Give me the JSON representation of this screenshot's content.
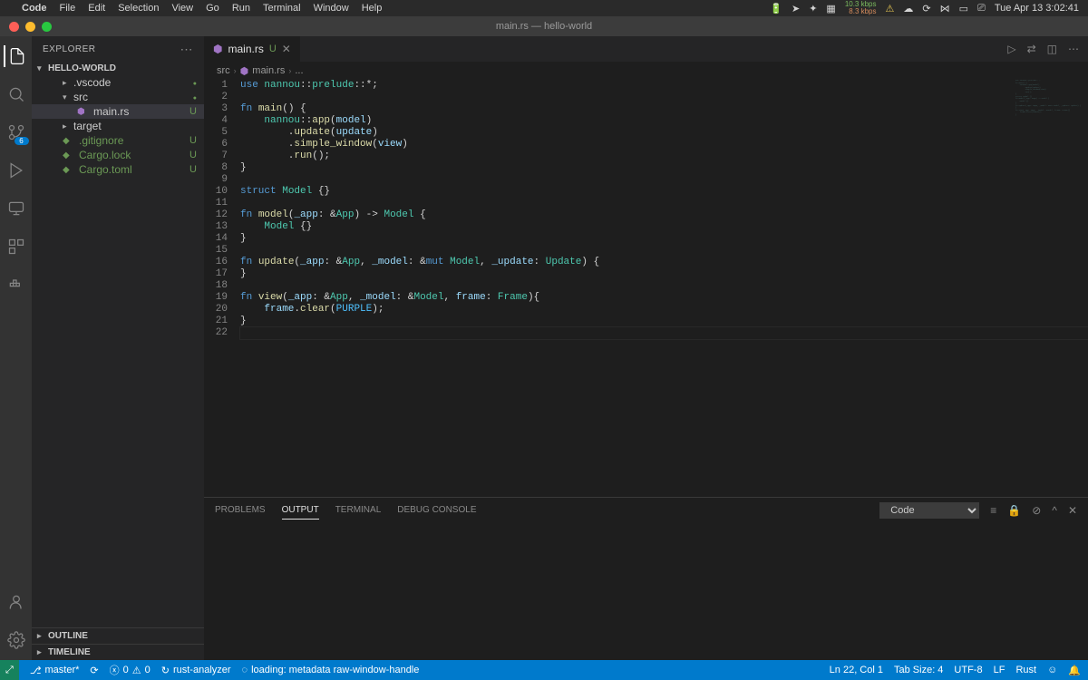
{
  "menubar": {
    "app": "Code",
    "items": [
      "File",
      "Edit",
      "Selection",
      "View",
      "Go",
      "Run",
      "Terminal",
      "Window",
      "Help"
    ],
    "clock": "Tue Apr 13  3:02:41",
    "net_up": "10.3 kbps",
    "net_down": "8.3 kbps"
  },
  "window": {
    "title": "main.rs — hello-world"
  },
  "sidebar": {
    "title": "EXPLORER",
    "root": "HELLO-WORLD",
    "items": [
      {
        "label": ".vscode",
        "type": "folder",
        "depth": 2,
        "status": "dot"
      },
      {
        "label": "src",
        "type": "folder-open",
        "depth": 2,
        "status": "dot"
      },
      {
        "label": "main.rs",
        "type": "file",
        "depth": 3,
        "status": "U",
        "selected": true
      },
      {
        "label": "target",
        "type": "folder",
        "depth": 2,
        "status": ""
      },
      {
        "label": ".gitignore",
        "type": "file",
        "depth": 2,
        "status": "U",
        "git": true
      },
      {
        "label": "Cargo.lock",
        "type": "file",
        "depth": 2,
        "status": "U",
        "git": true
      },
      {
        "label": "Cargo.toml",
        "type": "file",
        "depth": 2,
        "status": "U",
        "git": true
      }
    ],
    "outline": "OUTLINE",
    "timeline": "TIMELINE"
  },
  "activity": {
    "scm_badge": "6"
  },
  "editor": {
    "tab": {
      "icon": "⚙",
      "name": "main.rs",
      "mod": "U"
    },
    "breadcrumb": [
      "src",
      "main.rs",
      "..."
    ]
  },
  "code": {
    "lines": [
      [
        [
          "kw",
          "use"
        ],
        [
          "punc",
          " "
        ],
        [
          "mod",
          "nannou"
        ],
        [
          "punc",
          "::"
        ],
        [
          "mod",
          "prelude"
        ],
        [
          "punc",
          "::*;"
        ]
      ],
      [],
      [
        [
          "kw",
          "fn"
        ],
        [
          "punc",
          " "
        ],
        [
          "fn",
          "main"
        ],
        [
          "punc",
          "() {"
        ]
      ],
      [
        [
          "punc",
          "    "
        ],
        [
          "mod",
          "nannou"
        ],
        [
          "punc",
          "::"
        ],
        [
          "fn",
          "app"
        ],
        [
          "punc",
          "("
        ],
        [
          "var",
          "model"
        ],
        [
          "punc",
          ")"
        ]
      ],
      [
        [
          "punc",
          "        ."
        ],
        [
          "fn",
          "update"
        ],
        [
          "punc",
          "("
        ],
        [
          "var",
          "update"
        ],
        [
          "punc",
          ")"
        ]
      ],
      [
        [
          "punc",
          "        ."
        ],
        [
          "fn",
          "simple_window"
        ],
        [
          "punc",
          "("
        ],
        [
          "var",
          "view"
        ],
        [
          "punc",
          ")"
        ]
      ],
      [
        [
          "punc",
          "        ."
        ],
        [
          "fn",
          "run"
        ],
        [
          "punc",
          "();"
        ]
      ],
      [
        [
          "punc",
          "}"
        ]
      ],
      [],
      [
        [
          "kw",
          "struct"
        ],
        [
          "punc",
          " "
        ],
        [
          "type",
          "Model"
        ],
        [
          "punc",
          " {}"
        ]
      ],
      [],
      [
        [
          "kw",
          "fn"
        ],
        [
          "punc",
          " "
        ],
        [
          "fn",
          "model"
        ],
        [
          "punc",
          "("
        ],
        [
          "var",
          "_app"
        ],
        [
          "punc",
          ": &"
        ],
        [
          "type",
          "App"
        ],
        [
          "punc",
          ") -> "
        ],
        [
          "type",
          "Model"
        ],
        [
          "punc",
          " {"
        ]
      ],
      [
        [
          "punc",
          "    "
        ],
        [
          "type",
          "Model"
        ],
        [
          "punc",
          " {}"
        ]
      ],
      [
        [
          "punc",
          "}"
        ]
      ],
      [],
      [
        [
          "kw",
          "fn"
        ],
        [
          "punc",
          " "
        ],
        [
          "fn",
          "update"
        ],
        [
          "punc",
          "("
        ],
        [
          "var",
          "_app"
        ],
        [
          "punc",
          ": &"
        ],
        [
          "type",
          "App"
        ],
        [
          "punc",
          ", "
        ],
        [
          "var",
          "_model"
        ],
        [
          "punc",
          ": &"
        ],
        [
          "kw",
          "mut"
        ],
        [
          "punc",
          " "
        ],
        [
          "type",
          "Model"
        ],
        [
          "punc",
          ", "
        ],
        [
          "var",
          "_update"
        ],
        [
          "punc",
          ": "
        ],
        [
          "type",
          "Update"
        ],
        [
          "punc",
          ") {"
        ]
      ],
      [
        [
          "punc",
          "}"
        ]
      ],
      [],
      [
        [
          "kw",
          "fn"
        ],
        [
          "punc",
          " "
        ],
        [
          "fn",
          "view"
        ],
        [
          "punc",
          "("
        ],
        [
          "var",
          "_app"
        ],
        [
          "punc",
          ": &"
        ],
        [
          "type",
          "App"
        ],
        [
          "punc",
          ", "
        ],
        [
          "var",
          "_model"
        ],
        [
          "punc",
          ": &"
        ],
        [
          "type",
          "Model"
        ],
        [
          "punc",
          ", "
        ],
        [
          "var",
          "frame"
        ],
        [
          "punc",
          ": "
        ],
        [
          "type",
          "Frame"
        ],
        [
          "punc",
          "){"
        ]
      ],
      [
        [
          "punc",
          "    "
        ],
        [
          "var",
          "frame"
        ],
        [
          "punc",
          "."
        ],
        [
          "fn",
          "clear"
        ],
        [
          "punc",
          "("
        ],
        [
          "const",
          "PURPLE"
        ],
        [
          "punc",
          ");"
        ]
      ],
      [
        [
          "punc",
          "}"
        ]
      ],
      []
    ]
  },
  "panel": {
    "tabs": [
      "PROBLEMS",
      "OUTPUT",
      "TERMINAL",
      "DEBUG CONSOLE"
    ],
    "active": "OUTPUT",
    "select": "Code"
  },
  "status": {
    "branch": "master*",
    "sync": "⟳",
    "errors": "0",
    "warnings": "0",
    "lsp": "rust-analyzer",
    "loading": "loading: metadata raw-window-handle",
    "cursor": "Ln 22, Col 1",
    "tab_size": "Tab Size: 4",
    "encoding": "UTF-8",
    "eol": "LF",
    "lang": "Rust"
  }
}
